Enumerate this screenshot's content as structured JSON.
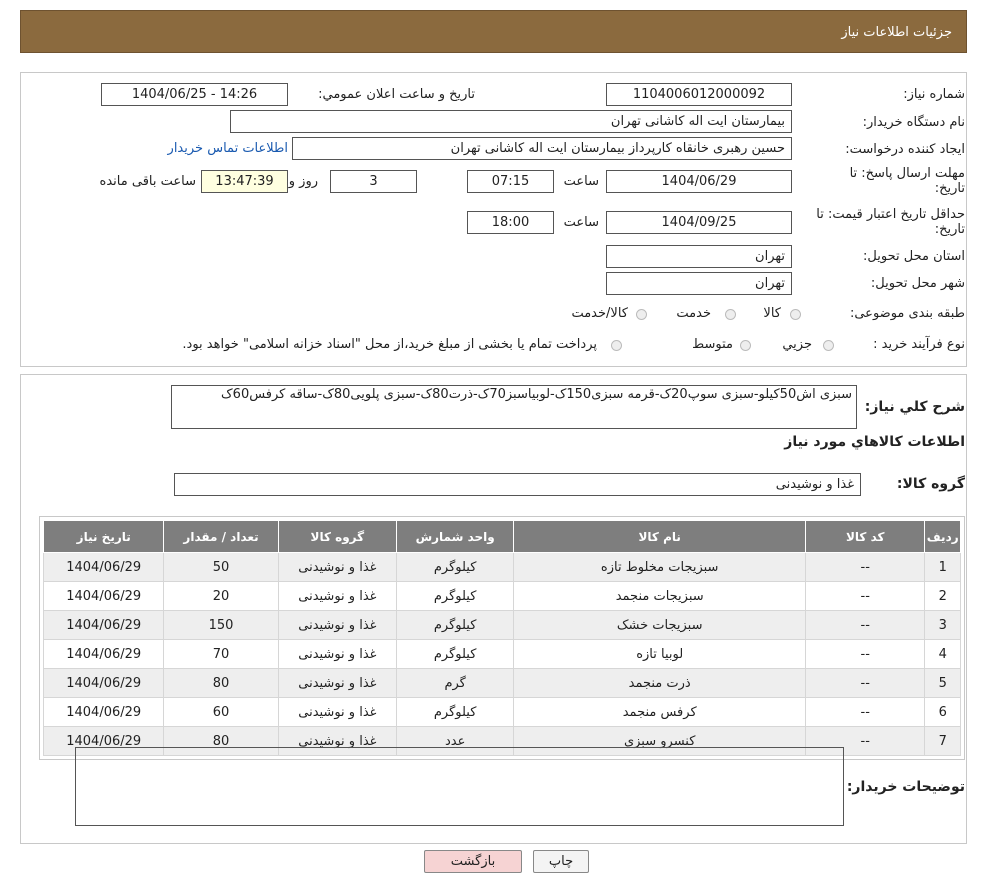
{
  "header": {
    "title": "جزئیات اطلاعات نیاز"
  },
  "info": {
    "need_number_label": "شماره نیاز:",
    "need_number": "1104006012000092",
    "announce_label": "تاریخ و ساعت اعلان عمومي:",
    "announce_value": "1404/06/25 - 14:26",
    "buyer_org_label": "نام دستگاه خریدار:",
    "buyer_org": "بیمارستان ایت اله کاشانی تهران",
    "creator_label": "ایجاد کننده درخواست:",
    "creator": "حسین رهبری خانقاه کارپرداز بیمارستان ایت اله کاشانی تهران",
    "contact_link": "اطلاعات تماس خریدار",
    "reply_deadline_label_1": "مهلت ارسال پاسخ: تا",
    "reply_deadline_label_2": "تاریخ:",
    "reply_date": "1404/06/29",
    "time_label": "ساعت",
    "reply_time": "07:15",
    "days": "3",
    "days_label": "روز و",
    "remaining": "13:47:39",
    "remaining_label": "ساعت باقی مانده",
    "price_validity_label_1": "حداقل تاریخ اعتبار قیمت: تا",
    "price_validity_label_2": "تاریخ:",
    "price_date": "1404/09/25",
    "price_time": "18:00",
    "province_label": "استان محل تحویل:",
    "province": "تهران",
    "city_label": "شهر محل تحویل:",
    "city": "تهران",
    "category_label": "طبقه بندی موضوعی:",
    "category_options": [
      "کالا",
      "خدمت",
      "کالا/خدمت"
    ],
    "process_label": "نوع فرآیند خرید :",
    "process_options": [
      "جزیي",
      "متوسط"
    ],
    "process_note": "پرداخت تمام یا بخشی از مبلغ خرید،از محل \"اسناد خزانه اسلامی\" خواهد بود."
  },
  "description": {
    "label": "شرح کلي نیاز:",
    "text": "سبزی اش50کیلو-سبزی سوپ20ک-قرمه سبزی150ک-لوبیاسبز70ک-ذرت80ک-سبزی پلویی80ک-ساقه کرفس60ک"
  },
  "goods": {
    "section_title": "اطلاعات کالاهاي مورد نیاز",
    "group_label": "گروه کالا:",
    "group_value": "غذا و نوشیدنی",
    "columns": [
      "ردیف",
      "کد کالا",
      "نام کالا",
      "واحد شمارش",
      "گروه کالا",
      "تعداد / مقدار",
      "تاریخ نیاز"
    ],
    "rows": [
      [
        "1",
        "--",
        "سبزیجات مخلوط تازه",
        "کیلوگرم",
        "غذا و نوشیدنی",
        "50",
        "1404/06/29"
      ],
      [
        "2",
        "--",
        "سبزیجات منجمد",
        "کیلوگرم",
        "غذا و نوشیدنی",
        "20",
        "1404/06/29"
      ],
      [
        "3",
        "--",
        "سبزیجات خشک",
        "کیلوگرم",
        "غذا و نوشیدنی",
        "150",
        "1404/06/29"
      ],
      [
        "4",
        "--",
        "لوبیا تازه",
        "کیلوگرم",
        "غذا و نوشیدنی",
        "70",
        "1404/06/29"
      ],
      [
        "5",
        "--",
        "ذرت منجمد",
        "گرم",
        "غذا و نوشیدنی",
        "80",
        "1404/06/29"
      ],
      [
        "6",
        "--",
        "کرفس منجمد",
        "کیلوگرم",
        "غذا و نوشیدنی",
        "60",
        "1404/06/29"
      ],
      [
        "7",
        "--",
        "کنسرو سبزی",
        "عدد",
        "غذا و نوشیدنی",
        "80",
        "1404/06/29"
      ]
    ]
  },
  "buyer_notes": {
    "label": "توضیحات خریدار:",
    "text": ""
  },
  "buttons": {
    "print": "چاپ",
    "back": "بازگشت"
  },
  "colors": {
    "header_bg": "#8b6a3e",
    "table_header_bg": "#7e7e7e",
    "link": "#1a5ab0",
    "back_button_bg": "#f6d3d3"
  }
}
